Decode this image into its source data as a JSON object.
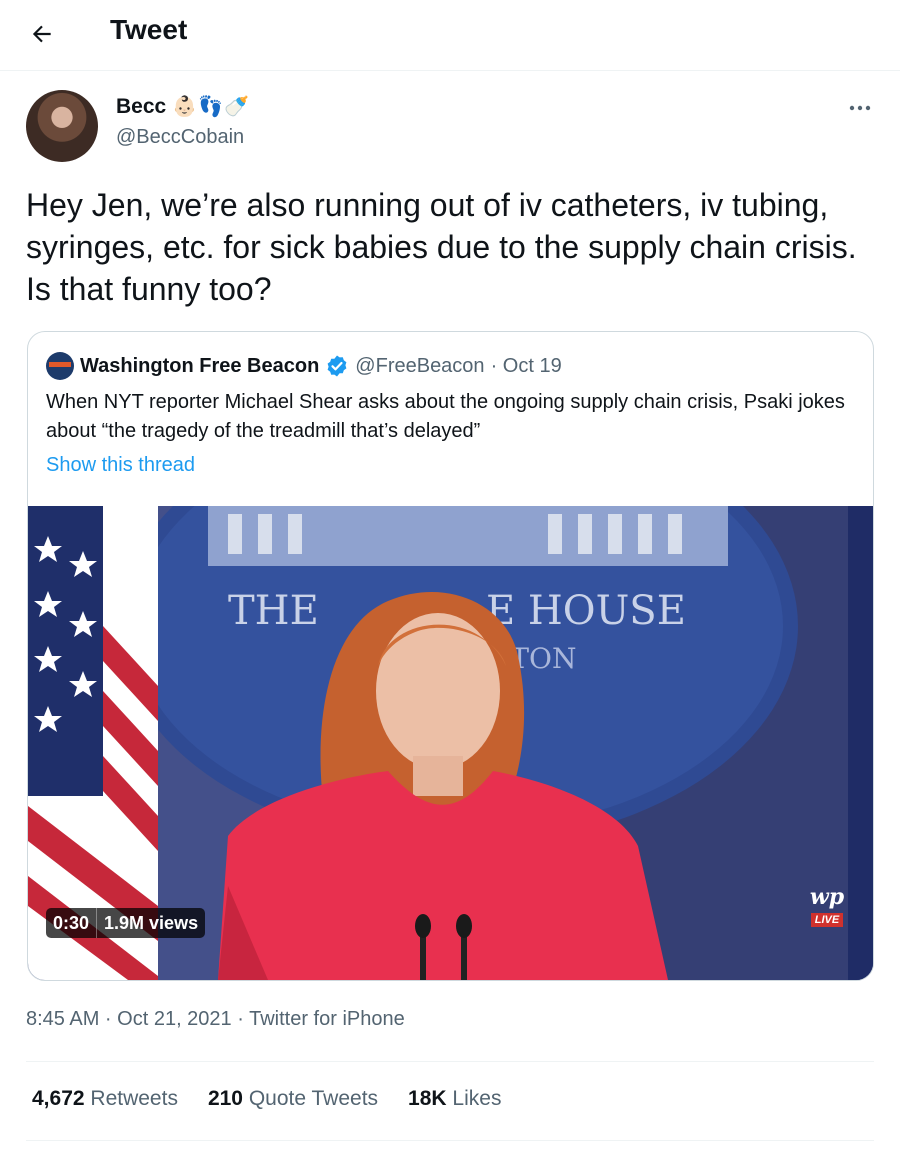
{
  "header": {
    "title": "Tweet"
  },
  "tweet": {
    "author": {
      "name": "Becc",
      "emojis": "👶🏻👣🍼",
      "handle": "@BeccCobain"
    },
    "text": "Hey Jen, we’re also running out of iv catheters, iv tubing, syringes, etc. for sick babies due to the supply chain crisis. Is that funny too?",
    "timestamp": "8:45 AM · Oct 21, 2021 · ",
    "source": "Twitter for iPhone"
  },
  "quote": {
    "name": "Washington Free Beacon",
    "handle": "@FreeBeacon",
    "date": "· Oct 19",
    "text": "When NYT reporter Michael Shear asks about the ongoing supply chain crisis, Psaki jokes about “the tragedy of the treadmill that’s delayed”",
    "thread_link": "Show this thread",
    "video": {
      "duration": "0:30",
      "views": "1.9M views",
      "wall_text_1": "THE",
      "wall_text_2": "E HOUSE",
      "wall_text_3": "GTON",
      "wp_logo": "wp",
      "wp_live": "LIVE"
    }
  },
  "stats": {
    "retweets": {
      "count": "4,672",
      "label": "Retweets"
    },
    "quotes": {
      "count": "210",
      "label": "Quote Tweets"
    },
    "likes": {
      "count": "18K",
      "label": "Likes"
    }
  },
  "colors": {
    "link": "#1d9bf0",
    "verified": "#1d9bf0",
    "muted": "#536471",
    "border": "#cfd9de"
  }
}
